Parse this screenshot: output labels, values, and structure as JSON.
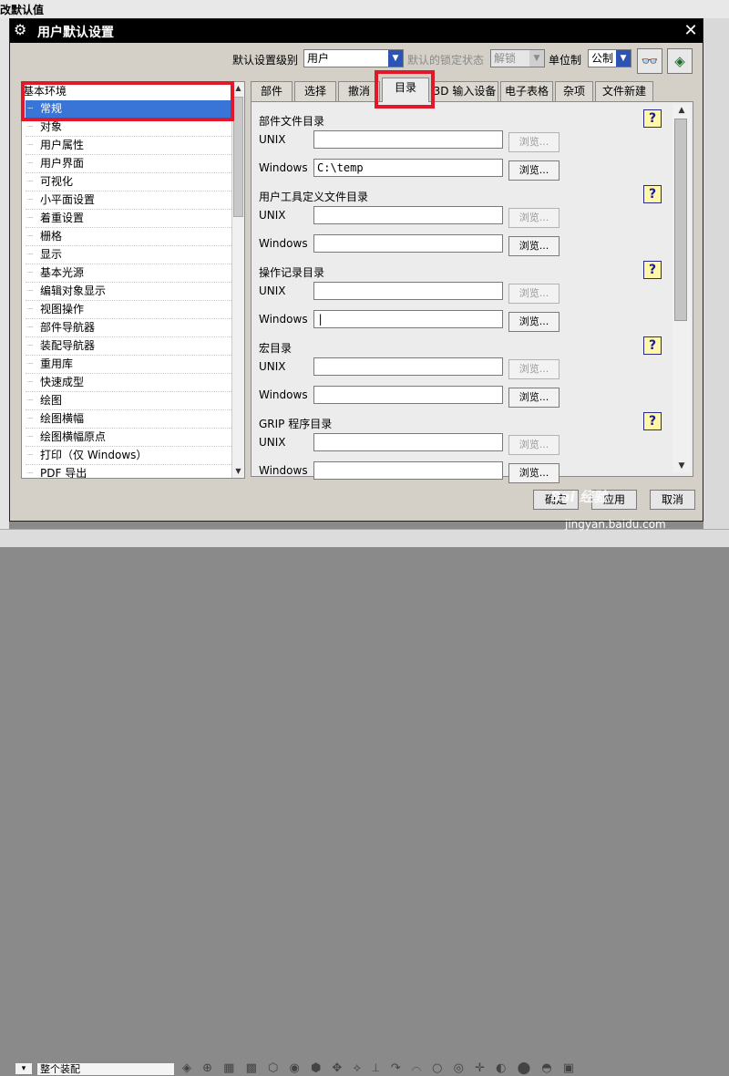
{
  "background": {
    "top_title": "改默认值",
    "bottom_combo": "整个装配",
    "bottom_icons": "◈ ⊕ ▦ ▩ ⬡ ◉ ⬢ ✥ ⟡ ⟂ ↷ ⌒ ○ ◎ ✛ ◐ ⬤ ◓ ▣"
  },
  "dialog": {
    "title": "用户默认设置",
    "close": "✕",
    "gear": "⚙"
  },
  "toolbar": {
    "level_label": "默认设置级别",
    "level_value": "用户",
    "lock_label": "默认的锁定状态",
    "lock_value": "解锁",
    "unit_label": "单位制",
    "unit_value": "公制",
    "icon_find": "find-icon",
    "icon_view": "eye-icon"
  },
  "tree": {
    "root": "基本环境",
    "items": [
      "常规",
      "对象",
      "用户属性",
      "用户界面",
      "可视化",
      "小平面设置",
      "着重设置",
      "栅格",
      "显示",
      "基本光源",
      "编辑对象显示",
      "视图操作",
      "部件导航器",
      "装配导航器",
      "重用库",
      "快速成型",
      "绘图",
      "绘图横幅",
      "绘图横幅原点",
      "打印（仅 Windows）",
      "PDF 导出"
    ],
    "selected_index": 0
  },
  "tabs": [
    "部件",
    "选择",
    "撤消",
    "目录",
    "3D 输入设备",
    "电子表格",
    "杂项",
    "文件新建"
  ],
  "active_tab_index": 3,
  "sections": [
    {
      "title": "部件文件目录",
      "unix_label": "UNIX",
      "unix_value": "",
      "windows_label": "Windows",
      "windows_value": "C:\\temp"
    },
    {
      "title": "用户工具定义文件目录",
      "unix_label": "UNIX",
      "unix_value": "",
      "windows_label": "Windows",
      "windows_value": ""
    },
    {
      "title": "操作记录目录",
      "unix_label": "UNIX",
      "unix_value": "",
      "windows_label": "Windows",
      "windows_value": "|"
    },
    {
      "title": "宏目录",
      "unix_label": "UNIX",
      "unix_value": "",
      "windows_label": "Windows",
      "windows_value": ""
    },
    {
      "title": "GRIP 程序目录",
      "unix_label": "UNIX",
      "unix_value": "",
      "windows_label": "Windows",
      "windows_value": ""
    }
  ],
  "browse_label": "浏览...",
  "help_label": "?",
  "buttons": {
    "ok": "确定",
    "apply": "应用",
    "cancel": "取消"
  },
  "watermark": "Bai 经验",
  "watermark_url": "jingyan.baidu.com"
}
